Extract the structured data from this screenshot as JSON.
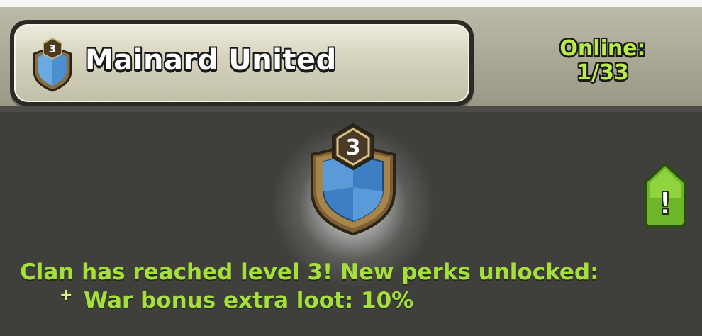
{
  "clan": {
    "name": "Mainard United",
    "level": "3"
  },
  "online": {
    "label": "Online:",
    "count": "1/33"
  },
  "announcement": {
    "message": "Clan has reached level 3! New perks unlocked:",
    "perks": [
      {
        "bullet": "+",
        "text": "War bonus extra loot: 10%"
      }
    ]
  },
  "alert_button": {
    "glyph": "!"
  },
  "colors": {
    "accent_green": "#a6df3d",
    "online_green": "#b8ec4a",
    "badge_blue": "#4b8fd0",
    "badge_gold": "#8a6c3d"
  }
}
